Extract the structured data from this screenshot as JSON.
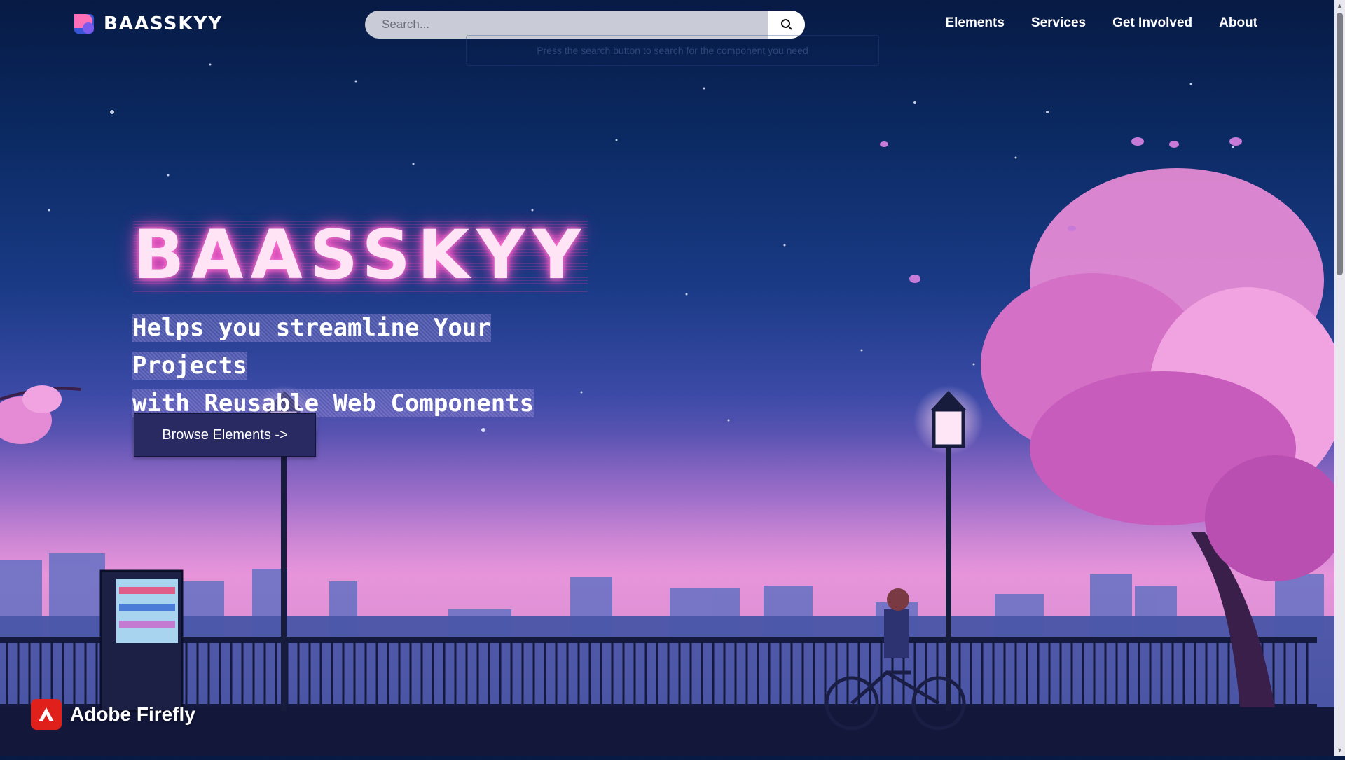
{
  "nav": {
    "brand": "BAASSKYY",
    "search_placeholder": "Search...",
    "ghost_hint": "Press the search button to search for the component you need",
    "menu": [
      {
        "label": "Elements"
      },
      {
        "label": "Services"
      },
      {
        "label": "Get Involved"
      },
      {
        "label": "About"
      }
    ]
  },
  "hero": {
    "title": "BAASSKYY",
    "tagline_line1": "Helps you streamline Your Projects",
    "tagline_line2": "with Reusable Web Components",
    "cta": "Browse Elements ->"
  },
  "watermark": {
    "label": "Adobe Firefly"
  },
  "colors": {
    "accent": "#ff59c8",
    "cta_bg": "#2a2a62",
    "firefly_red": "#e0201b"
  }
}
